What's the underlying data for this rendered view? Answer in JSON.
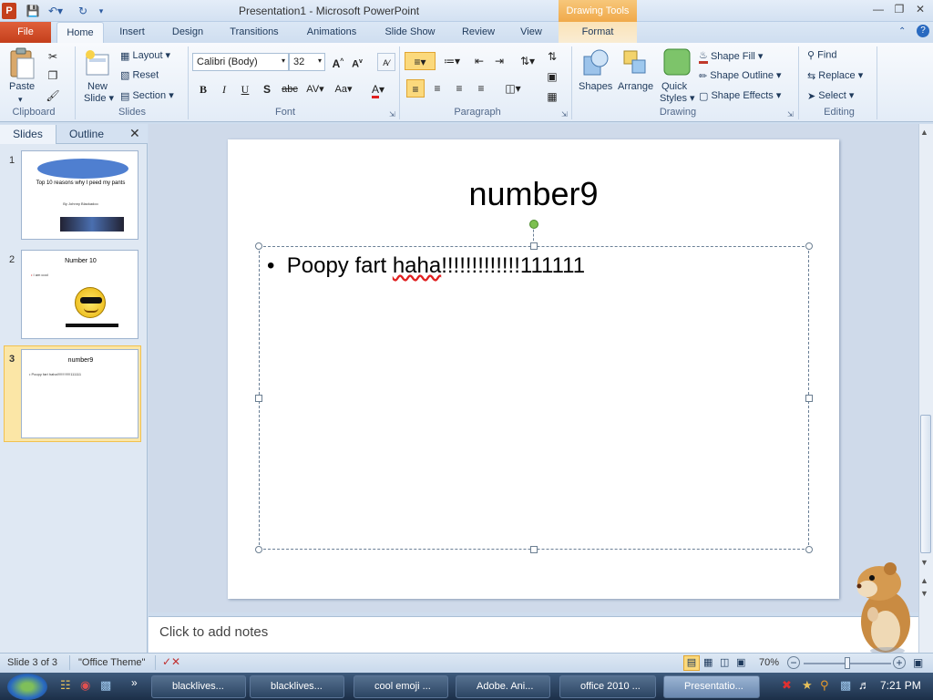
{
  "window": {
    "title": "Presentation1  -  Microsoft PowerPoint",
    "contextual_header": "Drawing Tools"
  },
  "tabs": [
    "File",
    "Home",
    "Insert",
    "Design",
    "Transitions",
    "Animations",
    "Slide Show",
    "Review",
    "View",
    "Format"
  ],
  "clipboard": {
    "paste": "Paste",
    "group": "Clipboard"
  },
  "slides_group": {
    "new_slide": "New",
    "new_slide2": "Slide ▾",
    "layout": "Layout ▾",
    "reset": "Reset",
    "section": "Section ▾",
    "group": "Slides"
  },
  "font_group": {
    "font_name": "Calibri (Body)",
    "font_size": "32",
    "group": "Font"
  },
  "paragraph_group": {
    "group": "Paragraph"
  },
  "drawing_group": {
    "shapes": "Shapes",
    "arrange": "Arrange",
    "quick": "Quick",
    "styles": "Styles ▾",
    "shape_fill": "Shape Fill ▾",
    "shape_outline": "Shape Outline ▾",
    "shape_effects": "Shape Effects ▾",
    "group": "Drawing"
  },
  "editing_group": {
    "find": "Find",
    "replace": "Replace ▾",
    "select": "Select ▾",
    "group": "Editing"
  },
  "pane": {
    "tab_slides": "Slides",
    "tab_outline": "Outline"
  },
  "thumbnails": [
    {
      "num": "1",
      "title": "Top 10 reasons why I peed my pants",
      "sub": "By Johnny Blackadoo"
    },
    {
      "num": "2",
      "title": "Number 10",
      "bullet": "I am cool"
    },
    {
      "num": "3",
      "title": "number9",
      "bullet": "Poopy fart haha!!!!!!!!!!!!!111111"
    }
  ],
  "slide": {
    "title": "number9",
    "bullet_prefix": "Poopy fart ",
    "bullet_word": "haha",
    "bullet_suffix": "!!!!!!!!!!!!!111111"
  },
  "notes": {
    "placeholder": "Click to add notes"
  },
  "status": {
    "slide": "Slide 3 of 3",
    "theme": "\"Office Theme\"",
    "zoom": "70%",
    "zoom_level": 0.5
  },
  "taskbar": {
    "items": [
      "blacklives...",
      "blacklives...",
      "cool emoji ...",
      "Adobe. Ani...",
      "office 2010 ...",
      "Presentatio..."
    ],
    "clock": "7:21 PM"
  },
  "colors": {
    "accent": "#c43f1c",
    "ribbon": "#dbe7f5",
    "contextual": "#f0a94a"
  }
}
